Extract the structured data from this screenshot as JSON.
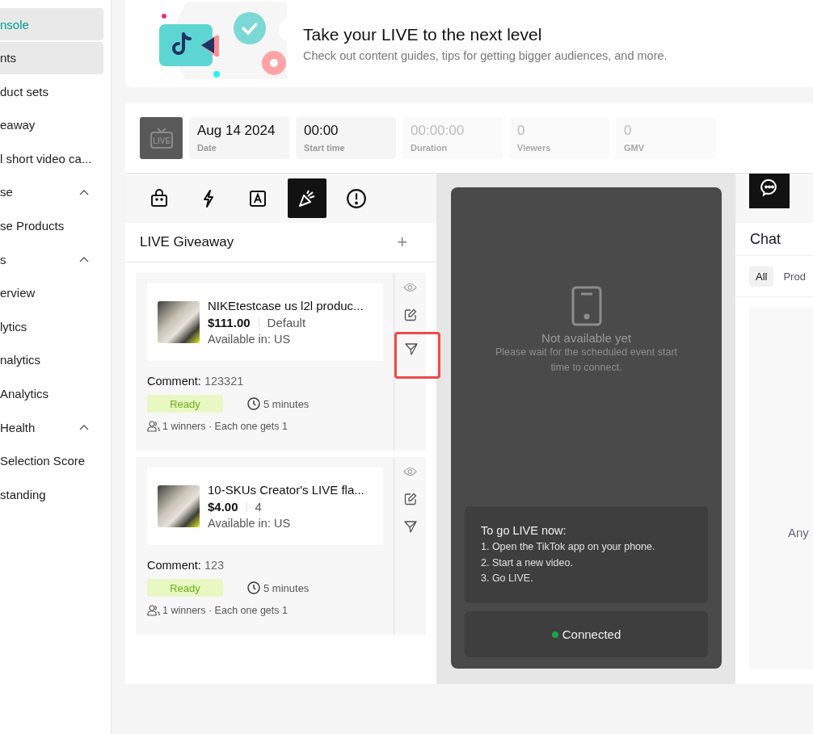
{
  "sidebar": {
    "items": [
      {
        "label": "nsole",
        "selected": true,
        "hovered": false
      },
      {
        "label": "nts",
        "selected": false,
        "hovered": true
      },
      {
        "label": "duct sets",
        "selected": false,
        "hovered": false
      },
      {
        "label": "eaway",
        "selected": false,
        "hovered": false
      },
      {
        "label": "l short video ca...",
        "selected": false,
        "hovered": false
      },
      {
        "label": "se",
        "selected": false,
        "hovered": false,
        "expanded": true
      },
      {
        "label": "se Products",
        "selected": false,
        "hovered": false
      },
      {
        "label": "s",
        "selected": false,
        "hovered": false,
        "expanded": true
      },
      {
        "label": "erview",
        "selected": false,
        "hovered": false
      },
      {
        "label": "lytics",
        "selected": false,
        "hovered": false
      },
      {
        "label": "nalytics",
        "selected": false,
        "hovered": false
      },
      {
        "label": "Analytics",
        "selected": false,
        "hovered": false
      },
      {
        "label": "Health",
        "selected": false,
        "hovered": false,
        "expanded": true
      },
      {
        "label": "Selection Score",
        "selected": false,
        "hovered": false
      },
      {
        "label": "standing",
        "selected": false,
        "hovered": false
      }
    ]
  },
  "live_badge": "LIVE",
  "banner": {
    "title": "Take your LIVE to the next level",
    "subtitle": "Check out content guides, tips for getting bigger audiences, and more."
  },
  "stats": [
    {
      "value": "Aug 14 2024",
      "label": "Date",
      "disabled": false
    },
    {
      "value": "00:00",
      "label": "Start time",
      "disabled": false
    },
    {
      "value": "00:00:00",
      "label": "Duration",
      "disabled": true
    },
    {
      "value": "0",
      "label": "Viewers",
      "disabled": true
    },
    {
      "value": "0",
      "label": "GMV",
      "disabled": true
    }
  ],
  "tool_tabs": [
    {
      "kind": "bag",
      "selected": false
    },
    {
      "kind": "flash",
      "selected": false
    },
    {
      "kind": "text",
      "selected": false
    },
    {
      "kind": "giveaway",
      "selected": true
    },
    {
      "kind": "alert",
      "selected": false
    }
  ],
  "giveaway": {
    "title": "LIVE Giveaway",
    "plus": "+",
    "cards": [
      {
        "product": "NIKEtestcase us l2l produc...",
        "price": "$111.00",
        "variant": "Default",
        "availability": "Available in: US",
        "comment_label": "Comment:",
        "comment": "123321",
        "status": "Ready",
        "duration": "5 minutes",
        "winners": "1 winners · Each one gets 1",
        "actions": [
          {
            "kind": "view",
            "highlighted": false
          },
          {
            "kind": "edit",
            "highlighted": false
          },
          {
            "kind": "send",
            "highlighted": true
          }
        ]
      },
      {
        "product": "10-SKUs Creator's LIVE fla...",
        "price": "$4.00",
        "variant": "4",
        "availability": "Available in: US",
        "comment_label": "Comment:",
        "comment": "123",
        "status": "Ready",
        "duration": "5 minutes",
        "winners": "1 winners · Each one gets 1",
        "actions": [
          {
            "kind": "view",
            "highlighted": false
          },
          {
            "kind": "edit",
            "highlighted": false
          },
          {
            "kind": "send",
            "highlighted": false
          }
        ]
      }
    ]
  },
  "preview": {
    "title": "Not available yet",
    "message": "Please wait for the scheduled event start time to connect.",
    "instructions_title": "To go LIVE now:",
    "steps": [
      "1. Open the TikTok app on your phone.",
      "2. Start a new video.",
      "3. Go LIVE."
    ],
    "status": {
      "label": "Connected",
      "color": "#1aa34a"
    }
  },
  "chat": {
    "title": "Chat",
    "filters": [
      {
        "label": "All",
        "selected": true
      },
      {
        "label": "Prod",
        "selected": false
      }
    ],
    "empty_text": "Any"
  }
}
